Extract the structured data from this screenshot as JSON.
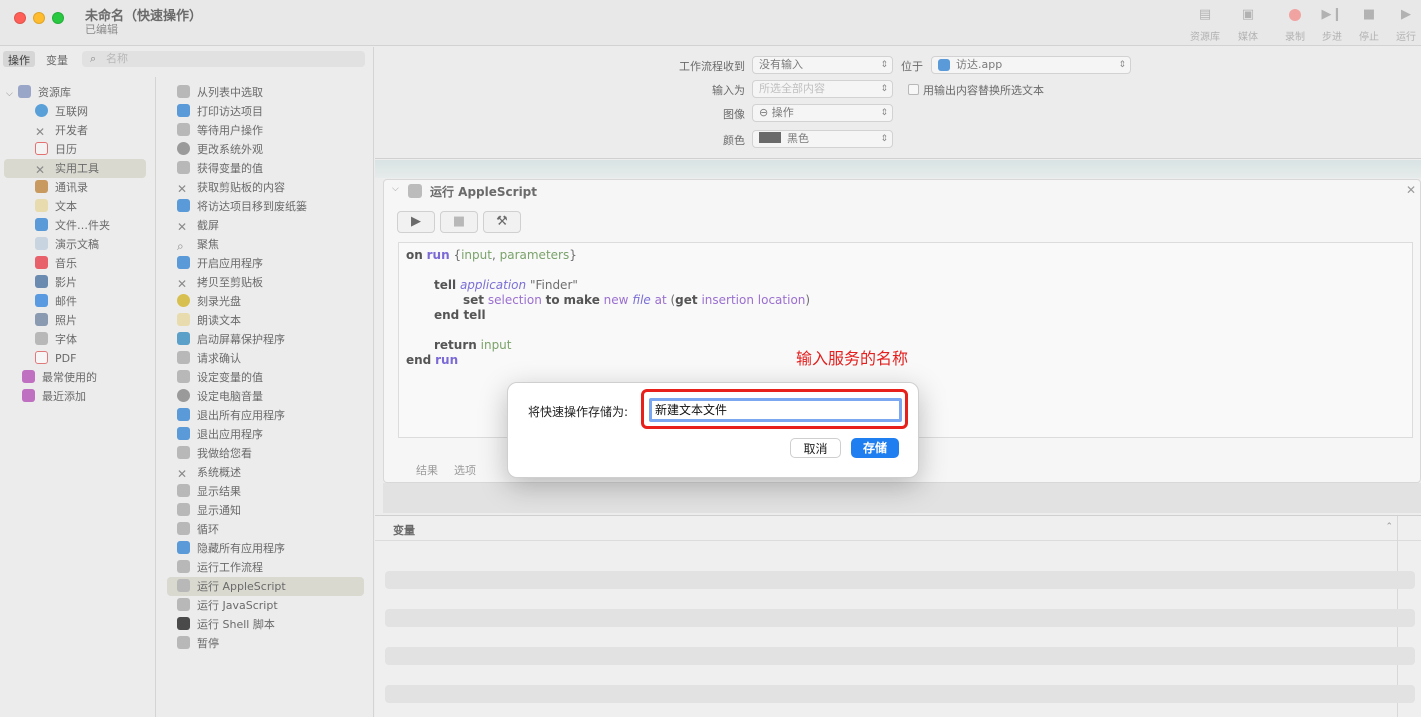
{
  "window": {
    "title": "未命名（快速操作）",
    "subtitle": "已编辑"
  },
  "toolbar": {
    "buttons": [
      {
        "label": "资源库",
        "icon": "library-icon"
      },
      {
        "label": "媒体",
        "icon": "media-icon"
      },
      {
        "label": "录制",
        "icon": "record-icon"
      },
      {
        "label": "步进",
        "icon": "step-icon"
      },
      {
        "label": "停止",
        "icon": "stop-icon"
      },
      {
        "label": "运行",
        "icon": "run-icon"
      }
    ]
  },
  "sidebar": {
    "tabs": [
      "操作",
      "变量"
    ],
    "search_placeholder": "名称",
    "library": [
      {
        "label": "资源库",
        "color": "#9aa6c8"
      },
      {
        "label": "互联网",
        "color": "#5aa0d8"
      },
      {
        "label": "开发者",
        "color": "#8a8a8a"
      },
      {
        "label": "日历",
        "color": "#e47070"
      },
      {
        "label": "实用工具",
        "color": "#8a8a8a"
      },
      {
        "label": "通讯录",
        "color": "#c89a60"
      },
      {
        "label": "文本",
        "color": "#d8c890"
      },
      {
        "label": "文件…件夹",
        "color": "#5a9ad8"
      },
      {
        "label": "演示文稿",
        "color": "#9ab0c8"
      },
      {
        "label": "音乐",
        "color": "#e8606a"
      },
      {
        "label": "影片",
        "color": "#6a8ab0"
      },
      {
        "label": "邮件",
        "color": "#5a9ae0"
      },
      {
        "label": "照片",
        "color": "#8a9ab0"
      },
      {
        "label": "字体",
        "color": "#a8a8a8"
      },
      {
        "label": "PDF",
        "color": "#e07a7a"
      },
      {
        "label": "最常使用的",
        "color": "#c070c0"
      },
      {
        "label": "最近添加",
        "color": "#c070c0"
      }
    ],
    "actions": [
      "从列表中选取",
      "打印访达项目",
      "等待用户操作",
      "更改系统外观",
      "获得变量的值",
      "获取剪贴板的内容",
      "将访达项目移到废纸篓",
      "截屏",
      "聚焦",
      "开启应用程序",
      "拷贝至剪贴板",
      "刻录光盘",
      "朗读文本",
      "启动屏幕保护程序",
      "请求确认",
      "设定变量的值",
      "设定电脑音量",
      "退出所有应用程序",
      "退出应用程序",
      "我做给您看",
      "系统概述",
      "显示结果",
      "显示通知",
      "循环",
      "隐藏所有应用程序",
      "运行工作流程",
      "运行 AppleScript",
      "运行 JavaScript",
      "运行 Shell 脚本",
      "暂停"
    ]
  },
  "workflow": {
    "receives_label": "工作流程收到",
    "receives_value": "没有输入",
    "in_label": "位于",
    "in_value": "访达.app",
    "input_is_label": "输入为",
    "input_is_value": "所选全部内容",
    "replace_label": "用输出内容替换所选文本",
    "image_label": "图像",
    "image_value": "⊖ 操作",
    "color_label": "颜色",
    "color_value": "黑色"
  },
  "action_card": {
    "title": "运行 AppleScript",
    "tabs": [
      "结果",
      "选项"
    ],
    "code": {
      "l1_on": "on",
      "l1_run": "run",
      "l1_brace1": " {",
      "l1_input": "input",
      "l1_comma": ", ",
      "l1_params": "parameters",
      "l1_brace2": "}",
      "l2_tell": "tell",
      "l2_application": "application",
      "l2_finder": " \"Finder\"",
      "l3_set": "set",
      "l3_selection": "selection",
      "l3_to": "to",
      "l3_make": "make",
      "l3_new": "new",
      "l3_file": "file",
      "l3_at": "at",
      "l3_paren": " (",
      "l3_get": "get",
      "l3_insertion": "insertion location",
      "l3_close": ")",
      "l4_end_tell": "end tell",
      "l5_return": "return",
      "l5_input": "input",
      "l6_end": "end",
      "l6_run": "run"
    }
  },
  "variables": {
    "title": "变量"
  },
  "annotation": "输入服务的名称",
  "dialog": {
    "label": "将快速操作存储为:",
    "value": "新建文本文件",
    "cancel": "取消",
    "save": "存储"
  }
}
